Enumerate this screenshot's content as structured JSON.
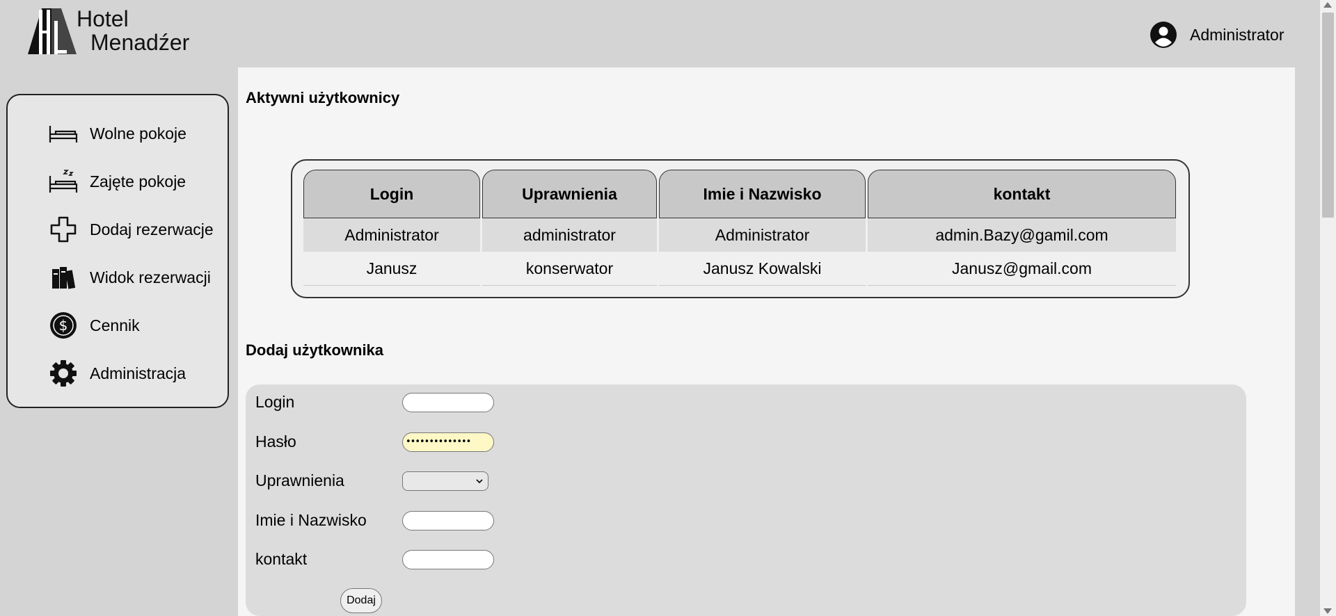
{
  "header": {
    "logo_line1": "Hotel",
    "logo_line2": "Menadźer",
    "user_name": "Administrator"
  },
  "sidebar": {
    "items": [
      {
        "label": "Wolne pokoje",
        "icon": "bed-icon"
      },
      {
        "label": "Zajęte pokoje",
        "icon": "sleeping-bed-icon"
      },
      {
        "label": "Dodaj rezerwacje",
        "icon": "plus-icon"
      },
      {
        "label": "Widok rezerwacji",
        "icon": "books-icon"
      },
      {
        "label": "Cennik",
        "icon": "dollar-icon"
      },
      {
        "label": "Administracja",
        "icon": "gear-icon"
      }
    ]
  },
  "users": {
    "title": "Aktywni użytkownicy",
    "columns": [
      "Login",
      "Uprawnienia",
      "Imie i Nazwisko",
      "kontakt"
    ],
    "rows": [
      [
        "Administrator",
        "administrator",
        "Administrator",
        "admin.Bazy@gamil.com"
      ],
      [
        "Janusz",
        "konserwator",
        "Janusz Kowalski",
        "Janusz@gmail.com"
      ]
    ]
  },
  "add_user": {
    "title": "Dodaj użytkownika",
    "fields": {
      "login_label": "Login",
      "password_label": "Hasło",
      "password_value": "••••••••••••••",
      "role_label": "Uprawnienia",
      "role_value": "",
      "name_label": "Imie i Nazwisko",
      "contact_label": "kontakt"
    },
    "submit_label": "Dodaj"
  },
  "colors": {
    "page_bg": "#d4d4d4",
    "main_bg": "#f5f5f5",
    "sidebar_bg": "#e6e6e6",
    "header_cell_bg": "#c8c8c8",
    "form_bg": "#dcdcdc",
    "password_autofill_bg": "#fdf8c6"
  }
}
